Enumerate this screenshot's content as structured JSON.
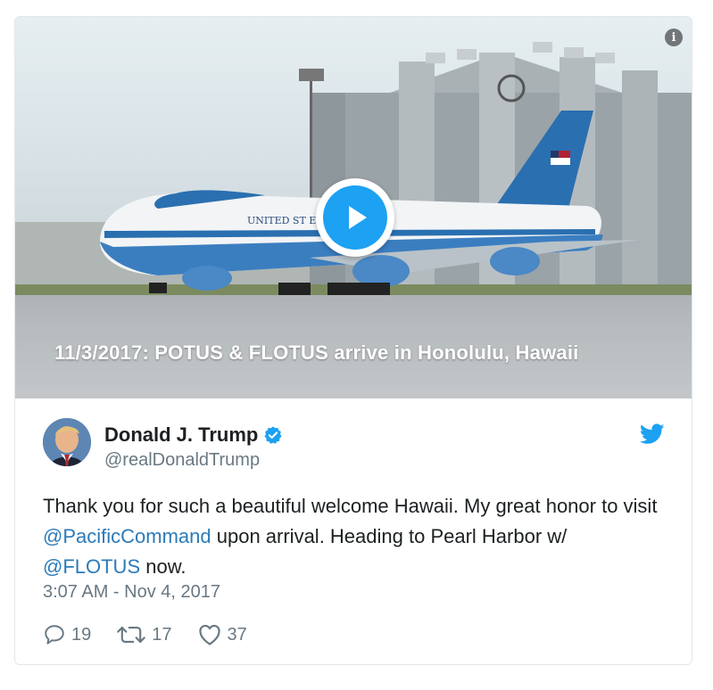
{
  "media": {
    "caption": "11/3/2017: POTUS & FLOTUS arrive in Honolulu, Hawaii",
    "plane_text": "UNITED ST    ERICA",
    "info_label": "i"
  },
  "author": {
    "name": "Donald J. Trump",
    "handle": "@realDonaldTrump",
    "verified": true
  },
  "tweet": {
    "text_1": "Thank you for such a beautiful welcome Hawaii. My great honor to visit ",
    "mention_1": "@PacificCommand",
    "text_2": " upon arrival. Heading to Pearl Harbor w/ ",
    "mention_2": "@FLOTUS",
    "text_3": " now.",
    "timestamp": "3:07 AM - Nov 4, 2017"
  },
  "actions": {
    "replies": "19",
    "retweets": "17",
    "likes": "37"
  },
  "colors": {
    "link": "#2b7bb9",
    "twitter_blue": "#1da1f2",
    "muted": "#697882"
  },
  "icons": [
    "info-icon",
    "play-icon",
    "verified-badge-icon",
    "twitter-bird-icon",
    "reply-icon",
    "retweet-icon",
    "like-icon"
  ]
}
